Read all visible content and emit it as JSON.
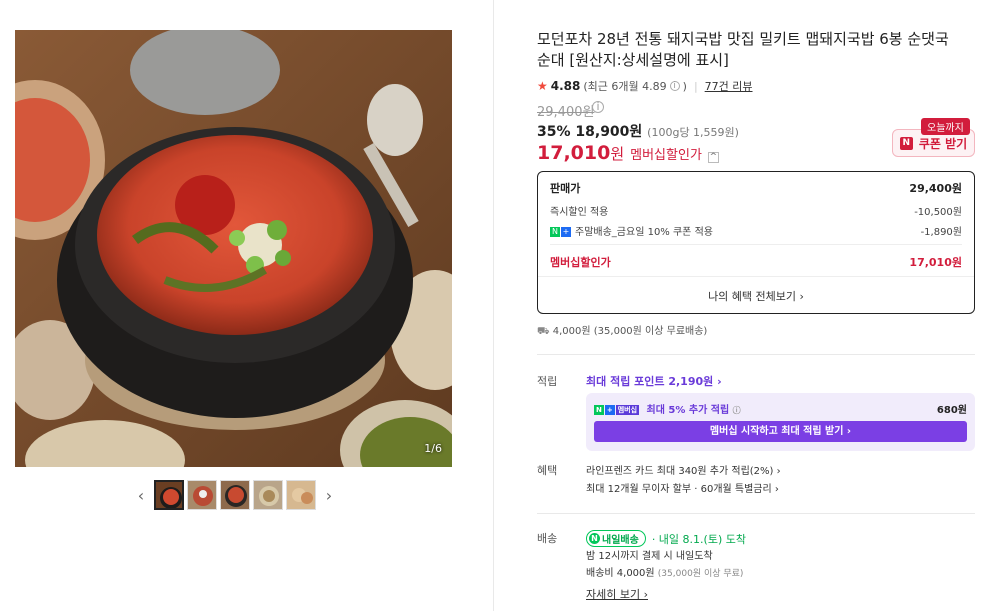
{
  "gallery": {
    "counter": "1/6",
    "prev_arrow": "‹",
    "next_arrow": "›",
    "thumb_count": 5
  },
  "product": {
    "title": "모던포차 28년 전통 돼지국밥 맛집 밀키트 맵돼지국밥 6봉 순댓국 순대 [원산지:상세설명에 표시]",
    "rating": "4.88",
    "rating_recent": "(최근 6개월 4.89",
    "rating_recent_close": ")",
    "reviews": "77건 리뷰",
    "original_price": "29,400원",
    "discount_rate": "35%",
    "sale_price": "18,900원",
    "unit_price": "(100g당 1,559원)",
    "member_price": "17,010",
    "member_won": "원",
    "member_label": "멤버십할인가",
    "today_badge": "오늘까지",
    "coupon_label": "쿠폰 받기"
  },
  "price_box": {
    "head_label": "판매가",
    "head_value": "29,400원",
    "rows": [
      {
        "label": "즉시할인 적용",
        "value": "-10,500원"
      },
      {
        "label": "주말배송_금요일 10% 쿠폰 적용",
        "value": "-1,890원"
      }
    ],
    "total_label": "멤버십할인가",
    "total_value": "17,010원",
    "benefit_link": "나의 혜택 전체보기 ›"
  },
  "shipping": {
    "fee_text": "4,000원 (35,000원 이상 무료배송)"
  },
  "points": {
    "label": "적립",
    "title": "최대 적립 포인트 2,190원 ›",
    "member_tag": "멤버십",
    "extra_label": "최대 5% 추가 적립",
    "extra_amount": "680원",
    "cta": "멤버십 시작하고 최대 적립 받기 ›"
  },
  "benefits": {
    "label": "혜택",
    "line1": "라인프렌즈 카드 최대 340원 추가 적립(2%) ›",
    "line2": "최대 12개월 무이자 할부 · 60개월 특별금리 ›"
  },
  "delivery": {
    "label": "배송",
    "badge": "내일배송",
    "arrival": "· 내일 8.1.(토) 도착",
    "line2": "밤 12시까지 결제 시 내일도착",
    "line3_main": "배송비 4,000원",
    "line3_sub": "(35,000원 이상 무료)",
    "more": "자세히 보기 ›"
  },
  "colors": {
    "accent_red": "#d21d3c",
    "accent_purple": "#7b3fe4",
    "accent_green": "#03c75a"
  }
}
